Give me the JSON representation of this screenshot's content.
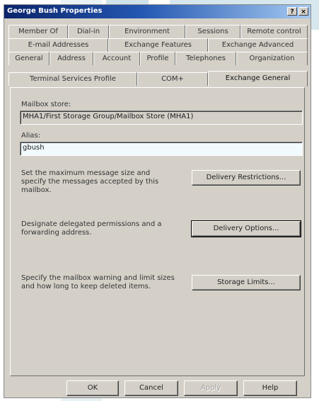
{
  "window": {
    "title": "George Bush Properties",
    "help_glyph": "?",
    "close_glyph": "×"
  },
  "tabs": {
    "row1": [
      "Member Of",
      "Dial-in",
      "Environment",
      "Sessions",
      "Remote control"
    ],
    "row2": [
      "E-mail Addresses",
      "Exchange Features",
      "Exchange Advanced"
    ],
    "row3": [
      "General",
      "Address",
      "Account",
      "Profile",
      "Telephones",
      "Organization"
    ],
    "row4": [
      "Terminal Services Profile",
      "COM+",
      "Exchange General"
    ],
    "active": "Exchange General"
  },
  "mailbox_store": {
    "label": "Mailbox store:",
    "value": "MHA1/First Storage Group/Mailbox Store (MHA1)"
  },
  "alias": {
    "label": "Alias:",
    "value": "gbush"
  },
  "delivery_restrictions": {
    "description": "Set the maximum message size and specify the messages accepted by this mailbox.",
    "button": "Delivery Restrictions..."
  },
  "delivery_options": {
    "description": "Designate delegated permissions and a forwarding address.",
    "button": "Delivery Options..."
  },
  "storage_limits": {
    "description": "Specify the mailbox warning and limit sizes and how long to keep deleted items.",
    "button": "Storage Limits..."
  },
  "footer": {
    "ok": "OK",
    "cancel": "Cancel",
    "apply": "Apply",
    "help": "Help"
  }
}
